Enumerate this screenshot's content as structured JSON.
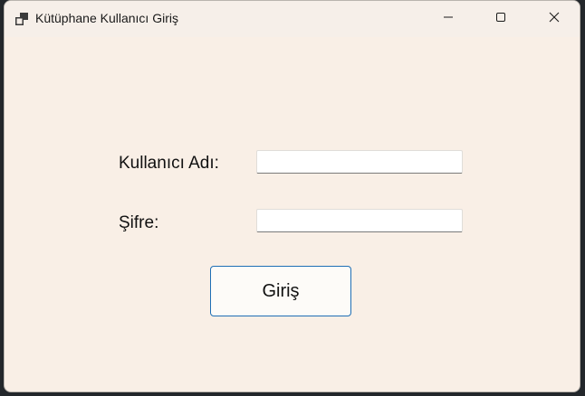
{
  "window": {
    "title": "Kütüphane Kullanıcı Giriş",
    "app_icon": "app-window-icon",
    "controls": {
      "minimize_icon": "minimize-icon",
      "maximize_icon": "maximize-icon",
      "close_icon": "close-icon"
    }
  },
  "form": {
    "username_label": "Kullanıcı Adı:",
    "username_value": "",
    "password_label": "Şifre:",
    "password_value": "",
    "login_label": "Giriş"
  },
  "colors": {
    "window_background": "#f9efe6",
    "button_border": "#1f6fb5"
  }
}
